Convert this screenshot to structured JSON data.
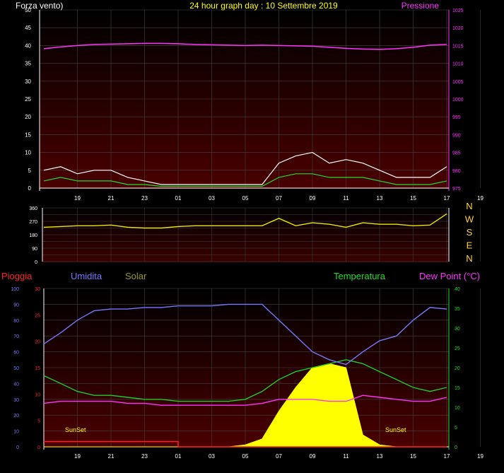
{
  "header": {
    "left_label": "Forza vento)",
    "title": "24 hour graph day : 10 Settembre 2019",
    "right_label": "Pressione"
  },
  "colors": {
    "wind": "#ffffff",
    "wind_avg": "#22dd22",
    "pressure": "#ff33ff",
    "direction": "#e8e800",
    "rain": "#ff2222",
    "humidity": "#7777ff",
    "solar": "#ffff00",
    "temperature": "#22cc22",
    "dewpoint": "#ff33ff",
    "compass": "#ffd24d",
    "temp_axis": "#22dd22",
    "dew_label": "#ff33ff",
    "grid": "#444444"
  },
  "time_ticks": [
    "19",
    "21",
    "23",
    "01",
    "03",
    "05",
    "07",
    "09",
    "11",
    "13",
    "15",
    "17",
    "19",
    "21",
    "23"
  ],
  "chart_data": [
    {
      "type": "line",
      "id": "wind-pressure",
      "x_hours": [
        17,
        18,
        19,
        20,
        21,
        22,
        23,
        24,
        25,
        26,
        27,
        28,
        29,
        30,
        31,
        32,
        33,
        34,
        35,
        36,
        37,
        38,
        39,
        40,
        41
      ],
      "series": [
        {
          "name": "Pressione",
          "axis": "right",
          "values": [
            1014.1,
            1014.6,
            1015.0,
            1015.3,
            1015.4,
            1015.5,
            1015.6,
            1015.6,
            1015.5,
            1015.3,
            1015.2,
            1015.1,
            1015.0,
            1015.1,
            1015.0,
            1014.9,
            1014.8,
            1014.5,
            1014.2,
            1014.0,
            1013.9,
            1014.1,
            1014.5,
            1015.1,
            1015.3
          ]
        },
        {
          "name": "Forza vento",
          "axis": "left",
          "values": [
            5,
            6,
            4,
            5,
            5,
            3,
            2,
            1,
            1,
            1,
            1,
            1,
            1,
            1,
            7,
            9,
            10,
            7,
            8,
            7,
            5,
            3,
            3,
            3,
            6
          ]
        },
        {
          "axis": "left",
          "values": [
            2,
            3,
            2,
            2,
            2,
            1,
            1,
            0.5,
            0.5,
            0.5,
            0.5,
            0.5,
            0.5,
            0.5,
            3,
            4,
            4,
            3,
            3,
            3,
            2,
            1,
            1,
            1,
            2
          ]
        }
      ],
      "left_axis": {
        "min": 0,
        "max": 50,
        "ticks": [
          0,
          5,
          10,
          15,
          20,
          25,
          30,
          35,
          40,
          45,
          50
        ]
      },
      "right_axis": {
        "min": 975,
        "max": 1025,
        "ticks": [
          975,
          980,
          985,
          990,
          995,
          1000,
          1005,
          1010,
          1015,
          1020,
          1025
        ]
      }
    },
    {
      "type": "line",
      "id": "wind-direction",
      "x_hours": [
        17,
        18,
        19,
        20,
        21,
        22,
        23,
        24,
        25,
        26,
        27,
        28,
        29,
        30,
        31,
        32,
        33,
        34,
        35,
        36,
        37,
        38,
        39,
        40,
        41
      ],
      "series": [
        {
          "values": [
            230,
            235,
            240,
            240,
            245,
            230,
            225,
            225,
            235,
            240,
            240,
            240,
            240,
            240,
            290,
            240,
            260,
            250,
            230,
            260,
            250,
            250,
            240,
            245,
            320
          ]
        }
      ],
      "y_axis": {
        "min": 0,
        "max": 360,
        "ticks": [
          0,
          45,
          90,
          135,
          180,
          225,
          270,
          315,
          360
        ]
      },
      "compass": [
        "N",
        "W",
        "S",
        "E",
        "N"
      ]
    },
    {
      "type": "area",
      "id": "rain-humidity-solar-temperature",
      "labels": [
        "Pioggia",
        "Umidita",
        "Solar",
        "Temperatura",
        "Dew Point (°C)"
      ],
      "annotations": [
        "SunSet",
        "SunSet"
      ],
      "x_hours": [
        17,
        18,
        19,
        20,
        21,
        22,
        23,
        24,
        25,
        26,
        27,
        28,
        29,
        30,
        31,
        32,
        33,
        34,
        35,
        36,
        37,
        38,
        39,
        40,
        41
      ],
      "series": [
        {
          "name": "Umidita",
          "axis": "humidity",
          "values": [
            65,
            72,
            80,
            86,
            87,
            87,
            88,
            88,
            89,
            89,
            89,
            90,
            90,
            90,
            80,
            70,
            60,
            55,
            52,
            60,
            67,
            70,
            80,
            88,
            87
          ]
        },
        {
          "name": "Temperatura",
          "axis": "temperature",
          "values": [
            18,
            16,
            14,
            13,
            13,
            12.5,
            12,
            12,
            11.5,
            11.5,
            11.5,
            11.5,
            12,
            14,
            17,
            19,
            20,
            21,
            22,
            21,
            19,
            17,
            15,
            14,
            15
          ]
        },
        {
          "name": "Dew Point (°C)",
          "axis": "temperature",
          "values": [
            11,
            11.5,
            11.5,
            11.5,
            11.5,
            11,
            11,
            10.5,
            10.5,
            10.5,
            10.5,
            10.5,
            10.5,
            11,
            12,
            12,
            12,
            11.5,
            11.5,
            13,
            12.5,
            12,
            11.5,
            11.5,
            12.5
          ]
        },
        {
          "name": "Solar",
          "axis": "temperature",
          "values": [
            0,
            0,
            0,
            0,
            0,
            0,
            0,
            0,
            0,
            0,
            0,
            0,
            0.5,
            2,
            9,
            15,
            20,
            21,
            20,
            3,
            0.5,
            0,
            0,
            0,
            0
          ]
        },
        {
          "name": "Pioggia",
          "axis": "rain",
          "values": [
            1,
            1,
            1,
            1,
            1,
            1,
            1,
            1,
            0,
            0,
            0,
            0,
            0,
            0,
            0,
            0,
            0,
            0,
            0,
            0,
            0,
            0,
            0,
            0,
            0
          ]
        }
      ],
      "humidity_axis": {
        "min": 0,
        "max": 100,
        "ticks": [
          0,
          10,
          20,
          30,
          40,
          50,
          60,
          70,
          80,
          90,
          100
        ]
      },
      "rain_axis": {
        "min": 0,
        "max": 30,
        "ticks": [
          0,
          5,
          10,
          15,
          20,
          25,
          30
        ]
      },
      "temperature_axis": {
        "min": 0,
        "max": 40,
        "ticks": [
          0,
          5,
          10,
          15,
          20,
          25,
          30,
          35,
          40
        ]
      }
    }
  ]
}
